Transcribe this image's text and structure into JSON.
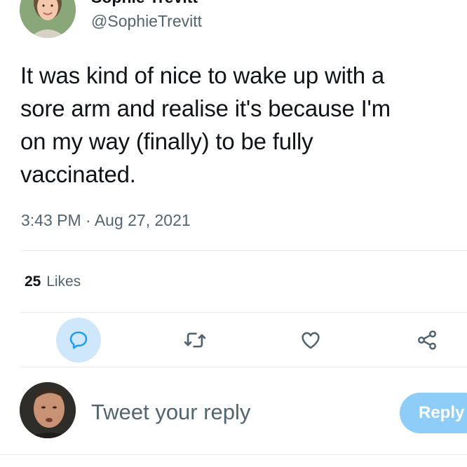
{
  "author": {
    "display_name": "Sophie Trevitt",
    "handle": "@SophieTrevitt"
  },
  "tweet": {
    "lines": [
      "It was kind of nice to wake up with a",
      "sore arm and realise it's because I'm",
      "on my way (finally) to be fully",
      "vaccinated."
    ],
    "timestamp": "3:43 PM · Aug 27, 2021"
  },
  "stats": {
    "likes_count": "25",
    "likes_label": "Likes"
  },
  "actions": {
    "reply_icon": "comment-bubble-icon",
    "retweet_icon": "retweet-icon",
    "like_icon": "heart-icon",
    "share_icon": "share-icon"
  },
  "composer": {
    "placeholder": "Tweet your reply",
    "button_label": "Reply"
  },
  "colors": {
    "text_primary": "#0f1419",
    "text_secondary": "#536471",
    "accent": "#1d9bf0",
    "reply_button_disabled": "#8ecdf8",
    "reply_highlight": "#cfe7fb"
  }
}
